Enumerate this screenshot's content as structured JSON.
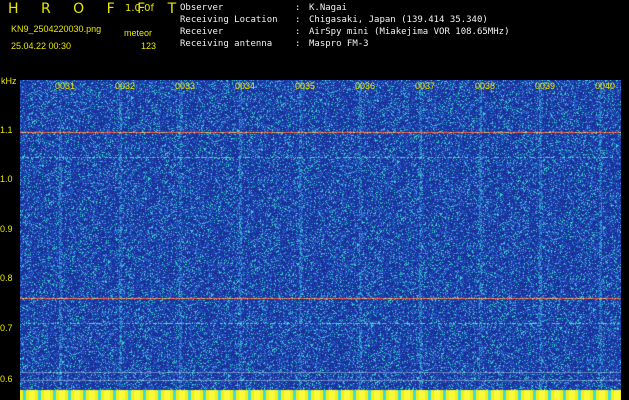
{
  "header": {
    "app_name": "H R O F F T",
    "version": "1.0.0f",
    "filename": "KN9_2504220030.png",
    "mode_label": "meteor",
    "datetime": "25.04.22 00:30",
    "count": "123"
  },
  "station": {
    "rows": [
      {
        "key": "Observer",
        "value": "K.Nagai"
      },
      {
        "key": "Receiving Location",
        "value": "Chigasaki, Japan (139.414 35.340)"
      },
      {
        "key": "Receiver",
        "value": "AirSpy mini (Miakejima VOR 108.65MHz)"
      },
      {
        "key": "Receiving antenna",
        "value": "Maspro FM-3"
      }
    ]
  },
  "axes": {
    "y_unit": "kHz",
    "y_ticks": [
      "1.1",
      "1.0",
      "0.9",
      "0.8",
      "0.7",
      "0.6"
    ],
    "x_ticks": [
      "0031",
      "0032",
      "0033",
      "0034",
      "0035",
      "0036",
      "0037",
      "0038",
      "0039",
      "0040"
    ]
  },
  "colors": {
    "background": "#000000",
    "label": "#e8e800",
    "noise_low": "#1a2f9a",
    "noise_mid": "#2a6bd4",
    "noise_high": "#3fd0c8",
    "signal": "#ff5a3c"
  }
}
